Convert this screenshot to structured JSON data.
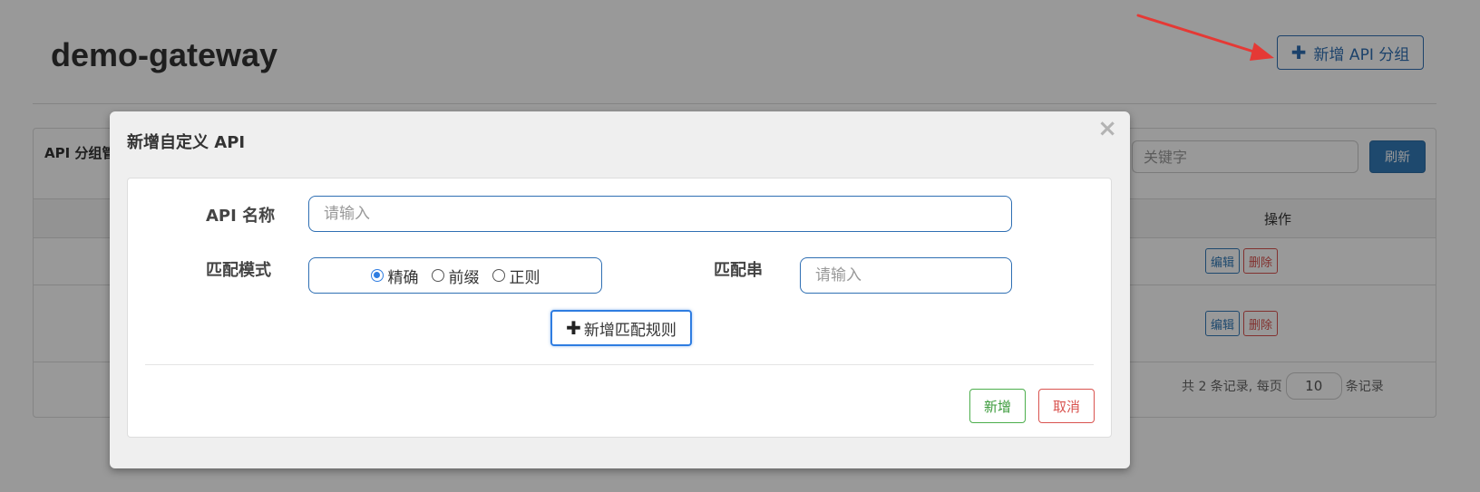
{
  "page": {
    "title": "demo-gateway",
    "add_group_label": "新增 API 分组"
  },
  "panel": {
    "title": "API 分组管理",
    "search_placeholder": "关键字",
    "refresh_label": "刷新",
    "operation_header": "操作",
    "rows": [
      {
        "edit_label": "编辑",
        "delete_label": "删除"
      },
      {
        "edit_label": "编辑",
        "delete_label": "删除"
      }
    ],
    "pagination": {
      "prefix": "共 2 条记录, 每页",
      "page_size": "10",
      "suffix": "条记录"
    }
  },
  "modal": {
    "title": "新增自定义 API",
    "close_symbol": "×",
    "name_label": "API 名称",
    "name_placeholder": "请输入",
    "mode_label": "匹配模式",
    "mode_options": [
      {
        "label": "精确",
        "checked": true
      },
      {
        "label": "前缀",
        "checked": false
      },
      {
        "label": "正则",
        "checked": false
      }
    ],
    "pattern_label": "匹配串",
    "pattern_placeholder": "请输入",
    "add_rule_label": "新增匹配规则",
    "confirm_label": "新增",
    "cancel_label": "取消"
  },
  "colors": {
    "primary": "#337ab7",
    "success": "#4cae4c",
    "danger": "#d9534f",
    "annotation_arrow": "#e53935"
  },
  "icons": [
    "plus-icon",
    "close-icon",
    "arrow-annotation"
  ]
}
